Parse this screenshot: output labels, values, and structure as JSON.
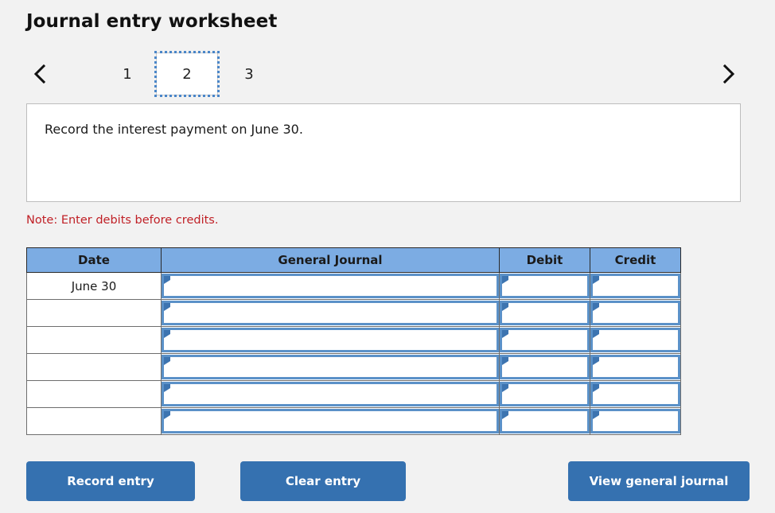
{
  "header": {
    "title": "Journal entry worksheet"
  },
  "pager": {
    "prev_icon": "chevron-left-icon",
    "next_icon": "chevron-right-icon",
    "pages": [
      {
        "label": "1",
        "selected": false
      },
      {
        "label": "2",
        "selected": true
      },
      {
        "label": "3",
        "selected": false
      }
    ],
    "selected_page": "2"
  },
  "instruction": {
    "text": "Record the interest payment on June 30."
  },
  "note": {
    "text": "Note: Enter debits before credits.",
    "color": "#c02026"
  },
  "table": {
    "columns": [
      "Date",
      "General Journal",
      "Debit",
      "Credit"
    ],
    "rows": [
      {
        "date": "June 30",
        "general_journal": "",
        "debit": "",
        "credit": ""
      },
      {
        "date": "",
        "general_journal": "",
        "debit": "",
        "credit": ""
      },
      {
        "date": "",
        "general_journal": "",
        "debit": "",
        "credit": ""
      },
      {
        "date": "",
        "general_journal": "",
        "debit": "",
        "credit": ""
      },
      {
        "date": "",
        "general_journal": "",
        "debit": "",
        "credit": ""
      },
      {
        "date": "",
        "general_journal": "",
        "debit": "",
        "credit": ""
      }
    ],
    "header_color": "#7cace3",
    "input_border_color": "#5b91c8"
  },
  "buttons": {
    "record_entry": "Record entry",
    "clear_entry": "Clear entry",
    "view_general_journal": "View general journal",
    "color": "#3571b0"
  }
}
